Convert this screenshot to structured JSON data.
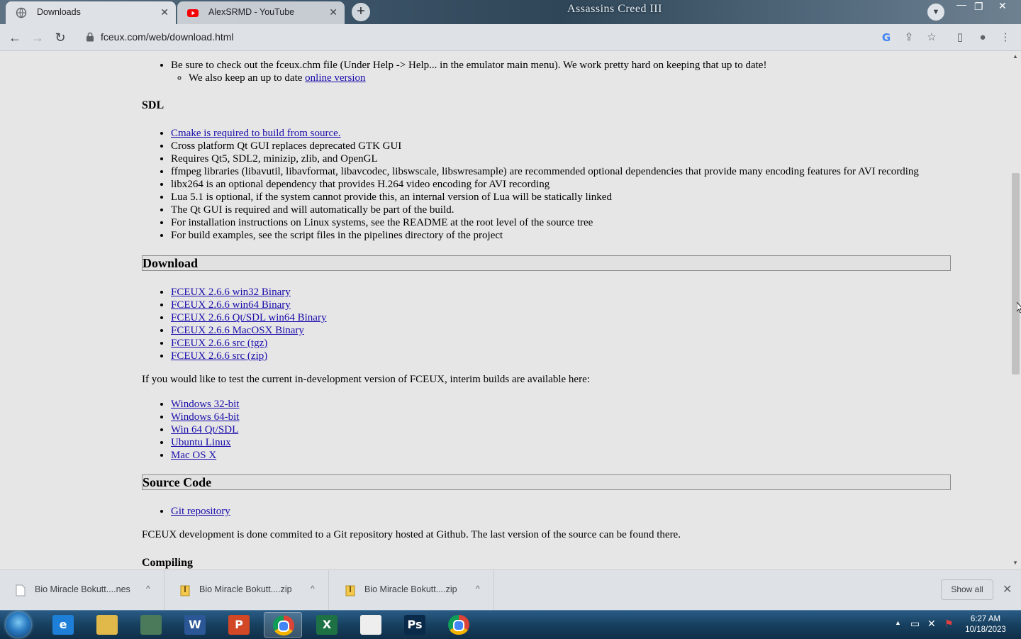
{
  "browser": {
    "tabs": [
      {
        "title": "Downloads",
        "active": true
      },
      {
        "title": "AlexSRMD - YouTube",
        "active": false
      }
    ],
    "new_tab_label": "+",
    "banner_text": "Assassins Creed III",
    "url": "fceux.com/web/download.html"
  },
  "page": {
    "help_list": [
      {
        "text": "Be sure to check out the fceux.chm file (Under Help -> Help... in the emulator main menu). We work pretty hard on keeping that up to date!"
      }
    ],
    "help_sub": {
      "prefix": "We also keep an up to date ",
      "link": "online version"
    },
    "sdl_heading": "SDL",
    "sdl_items": [
      {
        "text": "Cmake is required to build from source.",
        "link": true
      },
      {
        "text": "Cross platform Qt GUI replaces deprecated GTK GUI",
        "link": false
      },
      {
        "text": "Requires Qt5, SDL2, minizip, zlib, and OpenGL",
        "link": false
      },
      {
        "text": "ffmpeg libraries (libavutil, libavformat, libavcodec, libswscale, libswresample) are recommended optional dependencies that provide many encoding features for AVI recording",
        "link": false
      },
      {
        "text": "libx264 is an optional dependency that provides H.264 video encoding for AVI recording",
        "link": false
      },
      {
        "text": "Lua 5.1 is optional, if the system cannot provide this, an internal version of Lua will be statically linked",
        "link": false
      },
      {
        "text": "The Qt GUI is required and will automatically be part of the build.",
        "link": false
      },
      {
        "text": "For installation instructions on Linux systems, see the README at the root level of the source tree",
        "link": false
      },
      {
        "text": "For build examples, see the script files in the pipelines directory of the project",
        "link": false
      }
    ],
    "download_heading": "Download",
    "download_links": [
      "FCEUX 2.6.6 win32 Binary",
      "FCEUX 2.6.6 win64 Binary",
      "FCEUX 2.6.6 Qt/SDL win64 Binary",
      "FCEUX 2.6.6 MacOSX Binary",
      "FCEUX 2.6.6 src (tgz)",
      "FCEUX 2.6.6 src (zip)"
    ],
    "interim_text": "If you would like to test the current in-development version of FCEUX, interim builds are available here:",
    "interim_links": [
      "Windows 32-bit",
      "Windows 64-bit",
      "Win 64 Qt/SDL",
      "Ubuntu Linux",
      "Mac OS X"
    ],
    "source_heading": "Source Code",
    "source_links": [
      "Git repository"
    ],
    "source_text": "FCEUX development is done commited to a Git repository hosted at Github. The last version of the source can be found there.",
    "compiling_heading": "Compiling"
  },
  "downloads_shelf": {
    "items": [
      {
        "name": "Bio Miracle Bokutt....nes",
        "icon": "file-icon"
      },
      {
        "name": "Bio Miracle Bokutt....zip",
        "icon": "zip-icon"
      },
      {
        "name": "Bio Miracle Bokutt....zip",
        "icon": "zip-icon"
      }
    ],
    "show_all_label": "Show all"
  },
  "taskbar": {
    "apps": [
      {
        "name": "internet-explorer",
        "glyph": "e",
        "color": "#1e7fd8",
        "open": false
      },
      {
        "name": "file-explorer",
        "glyph": "",
        "color": "#e1b84a",
        "open": false
      },
      {
        "name": "desktop-app",
        "glyph": "",
        "color": "#4a7a5a",
        "open": false
      },
      {
        "name": "word",
        "glyph": "W",
        "color": "#2b5797",
        "open": false
      },
      {
        "name": "powerpoint",
        "glyph": "P",
        "color": "#d24726",
        "open": false
      },
      {
        "name": "chrome",
        "glyph": "",
        "color": "#4285f4",
        "open": true
      },
      {
        "name": "excel",
        "glyph": "X",
        "color": "#1e7145",
        "open": false
      },
      {
        "name": "document",
        "glyph": "",
        "color": "#eeeeee",
        "open": false
      },
      {
        "name": "photoshop",
        "glyph": "Ps",
        "color": "#0a2a4a",
        "open": false
      },
      {
        "name": "chrome-2",
        "glyph": "",
        "color": "#4285f4",
        "open": false
      }
    ],
    "time": "6:27 AM",
    "date": "10/18/2023"
  },
  "colors": {
    "link": "#1a0dab",
    "page_bg": "#e6e6e6",
    "heading_box": "#e1e1e1"
  }
}
